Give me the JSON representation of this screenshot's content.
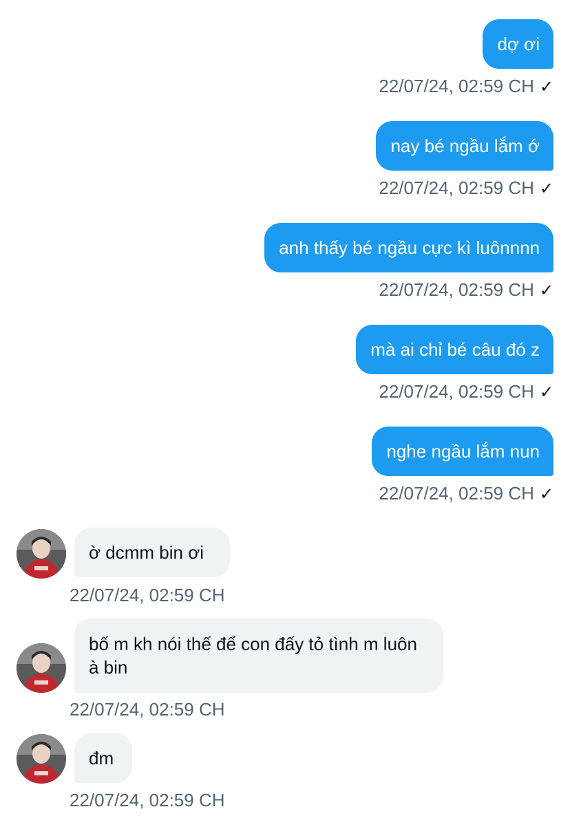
{
  "messages": [
    {
      "direction": "out",
      "text": "dợ ơi",
      "time": "22/07/24, 02:59 CH",
      "status": "✓"
    },
    {
      "direction": "out",
      "text": "nay bé ngầu lắm ớ",
      "time": "22/07/24, 02:59 CH",
      "status": "✓"
    },
    {
      "direction": "out",
      "text": "anh thấy bé ngầu cực kì luônnnn",
      "time": "22/07/24, 02:59 CH",
      "status": "✓"
    },
    {
      "direction": "out",
      "text": "mà ai chỉ bé câu đó z",
      "time": "22/07/24, 02:59 CH",
      "status": "✓"
    },
    {
      "direction": "out",
      "text": "nghe ngầu lắm nun",
      "time": "22/07/24, 02:59 CH",
      "status": "✓"
    },
    {
      "direction": "in",
      "text": "ờ dcmm bin ơi",
      "time": "22/07/24, 02:59 CH",
      "avatar": "user-avatar"
    },
    {
      "direction": "in",
      "text": "bố m kh nói thế để con đấy tỏ tình m luôn à bin",
      "time": "22/07/24, 02:59 CH",
      "avatar": "user-avatar"
    },
    {
      "direction": "in",
      "text": "đm",
      "time": "22/07/24, 02:59 CH",
      "avatar": "user-avatar"
    }
  ],
  "colors": {
    "outgoing_bubble": "#1d9bf0",
    "incoming_bubble": "#eff3f4",
    "timestamp": "#536471"
  }
}
